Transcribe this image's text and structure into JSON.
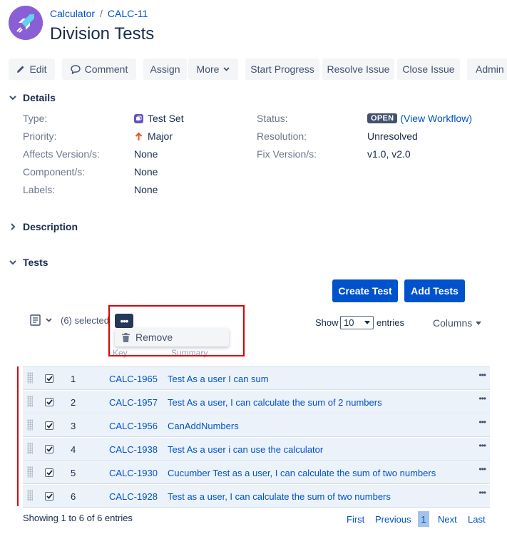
{
  "breadcrumb": {
    "project": "Calculator",
    "sep": "/",
    "issue_key": "CALC-11"
  },
  "page_title": "Division Tests",
  "toolbar": {
    "edit": "Edit",
    "comment": "Comment",
    "assign": "Assign",
    "more": "More",
    "start_progress": "Start Progress",
    "resolve_issue": "Resolve Issue",
    "close_issue": "Close Issue",
    "admin": "Admin"
  },
  "details": {
    "heading": "Details",
    "type_label": "Type:",
    "type_value": "Test Set",
    "priority_label": "Priority:",
    "priority_value": "Major",
    "affects_label": "Affects Version/s:",
    "affects_value": "None",
    "component_label": "Component/s:",
    "component_value": "None",
    "labels_label": "Labels:",
    "labels_value": "None",
    "status_label": "Status:",
    "status_value": "OPEN",
    "view_workflow": "(View Workflow)",
    "resolution_label": "Resolution:",
    "resolution_value": "Unresolved",
    "fix_label": "Fix Version/s:",
    "fix_value": "v1.0, v2.0"
  },
  "description": {
    "heading": "Description"
  },
  "tests": {
    "heading": "Tests",
    "create_test": "Create Test",
    "add_tests": "Add Tests",
    "selected_text": "(6) selected",
    "actions_menu": {
      "remove": "Remove"
    },
    "show_label": "Show",
    "entries_value": "10",
    "entries_label": "entries",
    "columns_label": "Columns",
    "col_key": "Key",
    "col_summary": "Summary",
    "rows": [
      {
        "num": "1",
        "key": "CALC-1965",
        "summary": "Test As a user I can sum"
      },
      {
        "num": "2",
        "key": "CALC-1957",
        "summary": "Test As a user, I can calculate the sum of 2 numbers"
      },
      {
        "num": "3",
        "key": "CALC-1956",
        "summary": "CanAddNumbers"
      },
      {
        "num": "4",
        "key": "CALC-1938",
        "summary": "Test As a user i can use the calculator"
      },
      {
        "num": "5",
        "key": "CALC-1930",
        "summary": "Cucumber Test as a user, I can calculate the sum of two numbers"
      },
      {
        "num": "6",
        "key": "CALC-1928",
        "summary": "Test as a user, I can calculate the sum of two numbers"
      }
    ],
    "footer": "Showing 1 to 6 of 6 entries",
    "pager": {
      "first": "First",
      "previous": "Previous",
      "current": "1",
      "next": "Next",
      "last": "Last"
    }
  },
  "colors": {
    "accent": "#0052cc",
    "highlight_box": "#e00000",
    "row_bg": "#ebf2f9",
    "avatar": "#8a5fd6"
  }
}
